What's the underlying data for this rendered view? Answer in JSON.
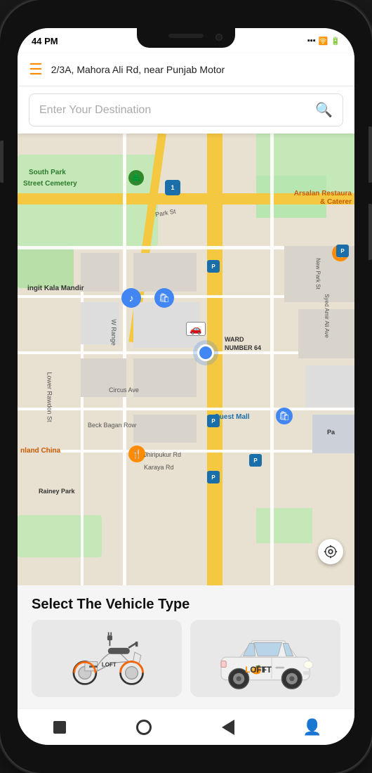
{
  "status_bar": {
    "time": "44 PM",
    "signal": "|||",
    "wifi": "WiFi",
    "battery": "🔋"
  },
  "location_bar": {
    "address": "2/3A, Mahora Ali Rd, near Punjab Motor"
  },
  "search": {
    "placeholder": "Enter Your Destination"
  },
  "map": {
    "labels": [
      {
        "id": "south_park",
        "text": "South Park",
        "type": "green"
      },
      {
        "id": "street_cemetery",
        "text": "Street Cemetery",
        "type": "green"
      },
      {
        "id": "arsalan",
        "text": "Arsalan Restaura",
        "type": "orange"
      },
      {
        "id": "caterer",
        "text": "& Caterer",
        "type": "orange"
      },
      {
        "id": "rangit_kala",
        "text": "ingit Kala Mandir",
        "type": "dark"
      },
      {
        "id": "ward_num",
        "text": "WARD NUMBER 64",
        "type": "dark"
      },
      {
        "id": "quest_mall",
        "text": "Quest Mall",
        "type": "blue"
      },
      {
        "id": "inland_china",
        "text": "nland China",
        "type": "orange"
      },
      {
        "id": "park_st",
        "text": "Park St",
        "type": "road"
      },
      {
        "id": "w_range",
        "text": "W Range",
        "type": "road"
      },
      {
        "id": "circus_ave",
        "text": "Circus Ave",
        "type": "road"
      },
      {
        "id": "beck_bagan",
        "text": "Beck Bagan Row",
        "type": "road"
      },
      {
        "id": "karaya_rd",
        "text": "Karaya Rd",
        "type": "road"
      },
      {
        "id": "lower_rawdon",
        "text": "Lower Rawdon St",
        "type": "road"
      },
      {
        "id": "new_park_st",
        "text": "New Park St",
        "type": "road"
      },
      {
        "id": "syed_amir",
        "text": "Syed Amir Ali Ave",
        "type": "road"
      },
      {
        "id": "rainey_park",
        "text": "Rainey Park",
        "type": "dark"
      },
      {
        "id": "ward_64",
        "text": "64",
        "type": "dark"
      }
    ]
  },
  "vehicle_section": {
    "title": "Select The Vehicle Type"
  },
  "navbar": {
    "items": [
      "stop",
      "home",
      "back",
      "person"
    ]
  },
  "colors": {
    "accent_orange": "#FF6600",
    "map_yellow": "#f5c842",
    "map_green": "#b8e6b0",
    "blue_marker": "#4286f4",
    "orange_marker": "#FF8C00"
  }
}
